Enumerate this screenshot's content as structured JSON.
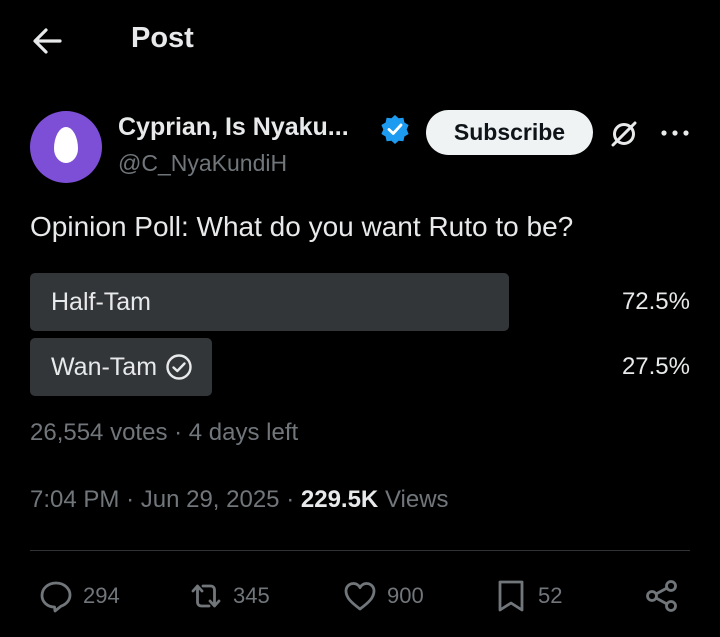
{
  "header": {
    "title": "Post"
  },
  "author": {
    "name": "Cyprian, Is Nyaku...",
    "handle": "@C_NyaKundiH",
    "avatar_color": "#7d4fd6",
    "verified": true
  },
  "subscribe_label": "Subscribe",
  "post": {
    "text": "Opinion Poll: What do you want Ruto to be?"
  },
  "poll": {
    "options": [
      {
        "label": "Half-Tam",
        "percent": "72.5%",
        "fraction": 0.725,
        "selected": false
      },
      {
        "label": "Wan-Tam",
        "percent": "27.5%",
        "fraction": 0.275,
        "selected": true
      }
    ],
    "votes": "26,554 votes",
    "separator": "·",
    "time_left": "4 days left"
  },
  "timestamp": {
    "time": "7:04 PM",
    "date": "Jun 29, 2025",
    "views_count": "229.5K",
    "views_label": "Views"
  },
  "actions": {
    "replies": "294",
    "reposts": "345",
    "likes": "900",
    "bookmarks": "52"
  },
  "colors": {
    "background": "#000000",
    "text": "#e7e9ea",
    "muted": "#71767b",
    "poll_bar": "#333639",
    "verified": "#1d9bf0"
  },
  "icons": [
    "back-arrow-icon",
    "verified-badge-icon",
    "grok-icon",
    "more-icon",
    "check-circle-icon",
    "reply-icon",
    "repost-icon",
    "like-icon",
    "bookmark-icon",
    "share-icon"
  ]
}
